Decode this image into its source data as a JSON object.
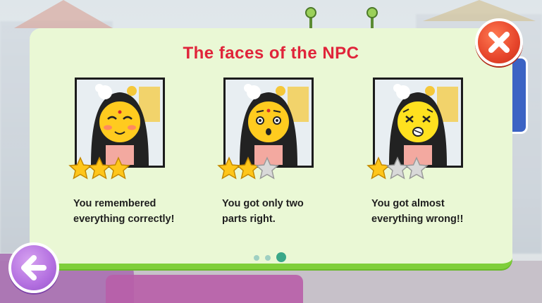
{
  "dialog": {
    "title": "The faces of the NPC",
    "cards": [
      {
        "caption_line1": "You remembered",
        "caption_line2": "everything correctly!",
        "stars_filled": 3,
        "stars_total": 3,
        "face": "happy"
      },
      {
        "caption_line1": "You got only two",
        "caption_line2": "parts right.",
        "stars_filled": 2,
        "stars_total": 3,
        "face": "surprised"
      },
      {
        "caption_line1": "You got almost",
        "caption_line2": "everything wrong!!",
        "stars_filled": 1,
        "stars_total": 3,
        "face": "shocked"
      }
    ],
    "pagination": {
      "total": 3,
      "active": 3
    }
  },
  "buttons": {
    "close": "close-icon",
    "back": "arrow-left-icon"
  },
  "colors": {
    "title": "#e0243a",
    "panel": "#eaf8d5",
    "panel_border": "#7fcf3a",
    "close": "#e6452b",
    "back": "#b36fe0",
    "star": "#ffc61a",
    "star_empty": "#d9d9d9"
  }
}
